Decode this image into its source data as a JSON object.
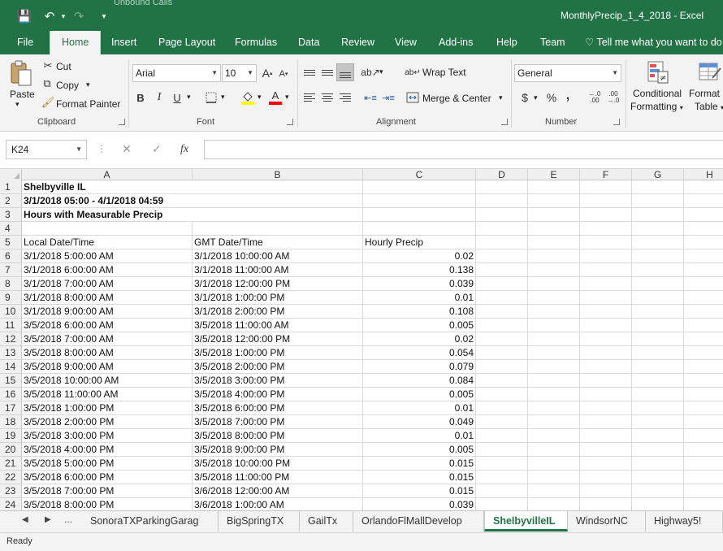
{
  "app": {
    "title": "MonthlyPrecip_1_4_2018  -  Excel",
    "ghost_caption": "Unbound Calls",
    "accent_color": "#217346"
  },
  "quick_access": {
    "save": "💾",
    "undo": "↶",
    "redo": "↷",
    "customize": "▾"
  },
  "menu_tabs": [
    "File",
    "Home",
    "Insert",
    "Page Layout",
    "Formulas",
    "Data",
    "Review",
    "View",
    "Add-ins",
    "Help",
    "Team",
    "Tell me what you want to do"
  ],
  "ribbon": {
    "clipboard": {
      "paste": "Paste",
      "cut": "Cut",
      "copy": "Copy",
      "format_painter": "Format Painter",
      "label": "Clipboard"
    },
    "font": {
      "name": "Arial",
      "size": "10",
      "grow": "A",
      "shrink": "A",
      "bold": "B",
      "italic": "I",
      "underline": "U",
      "label": "Font"
    },
    "alignment": {
      "wrap_text": "Wrap Text",
      "merge_center": "Merge & Center",
      "label": "Alignment"
    },
    "number": {
      "format": "General",
      "currency": "$",
      "percent": "%",
      "comma": ",",
      "inc_decimal": ".00",
      "dec_decimal": ".00",
      "label": "Number"
    },
    "styles": {
      "conditional_formatting": "Conditional Formatting",
      "cf_line1": "Conditional",
      "cf_line2": "Formatting",
      "format_table_line1": "Format",
      "format_table_line2": "Table"
    }
  },
  "formula_bar": {
    "name_box": "K24",
    "cancel": "✕",
    "enter": "✓",
    "fx": "fx",
    "value": ""
  },
  "columns": [
    "A",
    "B",
    "C",
    "D",
    "E",
    "F",
    "G",
    "H"
  ],
  "rows": [
    {
      "n": "1",
      "a": "Shelbyville IL",
      "b": "",
      "c": "",
      "bold": true
    },
    {
      "n": "2",
      "a": "3/1/2018 05:00 - 4/1/2018 04:59",
      "b": "",
      "c": "",
      "bold": true
    },
    {
      "n": "3",
      "a": "Hours with Measurable Precip",
      "b": "",
      "c": "",
      "bold": true
    },
    {
      "n": "4",
      "a": "",
      "b": "",
      "c": ""
    },
    {
      "n": "5",
      "a": "Local Date/Time",
      "b": "GMT Date/Time",
      "c": "Hourly Precip",
      "header": true
    },
    {
      "n": "6",
      "a": "3/1/2018 5:00:00 AM",
      "b": "3/1/2018 10:00:00 AM",
      "c": "0.02"
    },
    {
      "n": "7",
      "a": "3/1/2018 6:00:00 AM",
      "b": "3/1/2018 11:00:00 AM",
      "c": "0.138"
    },
    {
      "n": "8",
      "a": "3/1/2018 7:00:00 AM",
      "b": "3/1/2018 12:00:00 PM",
      "c": "0.039"
    },
    {
      "n": "9",
      "a": "3/1/2018 8:00:00 AM",
      "b": "3/1/2018 1:00:00 PM",
      "c": "0.01"
    },
    {
      "n": "10",
      "a": "3/1/2018 9:00:00 AM",
      "b": "3/1/2018 2:00:00 PM",
      "c": "0.108"
    },
    {
      "n": "11",
      "a": "3/5/2018 6:00:00 AM",
      "b": "3/5/2018 11:00:00 AM",
      "c": "0.005"
    },
    {
      "n": "12",
      "a": "3/5/2018 7:00:00 AM",
      "b": "3/5/2018 12:00:00 PM",
      "c": "0.02"
    },
    {
      "n": "13",
      "a": "3/5/2018 8:00:00 AM",
      "b": "3/5/2018 1:00:00 PM",
      "c": "0.054"
    },
    {
      "n": "14",
      "a": "3/5/2018 9:00:00 AM",
      "b": "3/5/2018 2:00:00 PM",
      "c": "0.079"
    },
    {
      "n": "15",
      "a": "3/5/2018 10:00:00 AM",
      "b": "3/5/2018 3:00:00 PM",
      "c": "0.084"
    },
    {
      "n": "16",
      "a": "3/5/2018 11:00:00 AM",
      "b": "3/5/2018 4:00:00 PM",
      "c": "0.005"
    },
    {
      "n": "17",
      "a": "3/5/2018 1:00:00 PM",
      "b": "3/5/2018 6:00:00 PM",
      "c": "0.01"
    },
    {
      "n": "18",
      "a": "3/5/2018 2:00:00 PM",
      "b": "3/5/2018 7:00:00 PM",
      "c": "0.049"
    },
    {
      "n": "19",
      "a": "3/5/2018 3:00:00 PM",
      "b": "3/5/2018 8:00:00 PM",
      "c": "0.01"
    },
    {
      "n": "20",
      "a": "3/5/2018 4:00:00 PM",
      "b": "3/5/2018 9:00:00 PM",
      "c": "0.005"
    },
    {
      "n": "21",
      "a": "3/5/2018 5:00:00 PM",
      "b": "3/5/2018 10:00:00 PM",
      "c": "0.015"
    },
    {
      "n": "22",
      "a": "3/5/2018 6:00:00 PM",
      "b": "3/5/2018 11:00:00 PM",
      "c": "0.015"
    },
    {
      "n": "23",
      "a": "3/5/2018 7:00:00 PM",
      "b": "3/6/2018 12:00:00 AM",
      "c": "0.015"
    },
    {
      "n": "24",
      "a": "3/5/2018 8:00:00 PM",
      "b": "3/6/2018 1:00:00 AM",
      "c": "0.039"
    }
  ],
  "sheet_tabs": [
    "SonoraTXParkingGarag",
    "BigSpringTX",
    "GailTx",
    "OrlandoFlMallDevelop",
    "ShelbyvilleIL",
    "WindsorNC",
    "Highway5!"
  ],
  "active_sheet": "ShelbyvilleIL",
  "sheet_nav": {
    "prev": "◀",
    "next": "▶",
    "more": "..."
  },
  "status": {
    "text": "Ready"
  }
}
